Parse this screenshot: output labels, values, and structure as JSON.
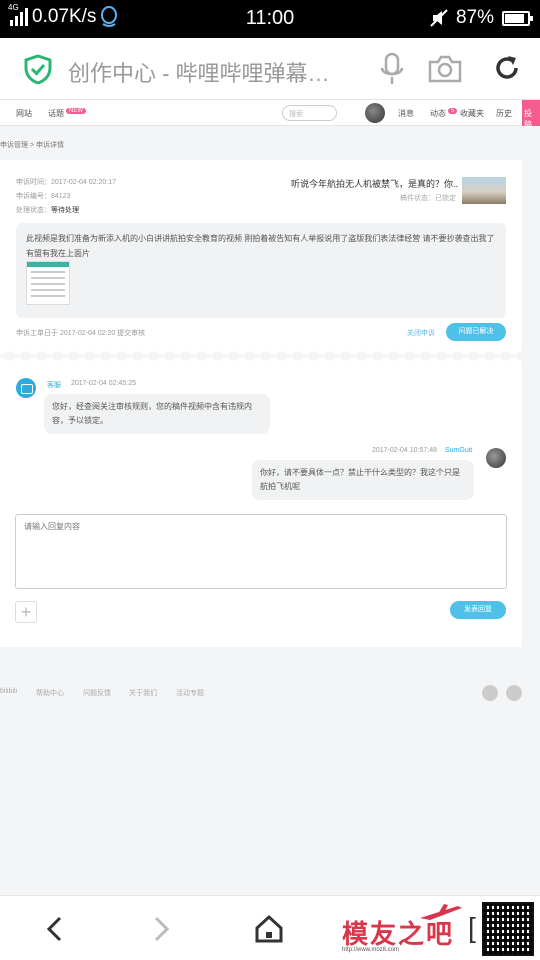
{
  "status_bar": {
    "network": "4G",
    "speed": "0.07K/s",
    "time": "11:00",
    "battery": "87%",
    "battery_level": 0.87
  },
  "browser": {
    "title": "创作中心 - 哔哩哔哩弹幕…"
  },
  "site_nav": {
    "items": [
      "网站",
      "话题",
      "消息",
      "动态",
      "收藏夹",
      "历史"
    ],
    "search_placeholder": "搜索",
    "dynamic_badge": "5",
    "topic_badge": "NEW",
    "pink_tab": "投稿"
  },
  "breadcrumb": "申诉管理 > 申诉详情",
  "appeal": {
    "time_label": "申诉时间：2017-02-04 02:20:17",
    "id_label": "申诉编号：84123",
    "status_label": "处理状态：",
    "status_value": "等待处理",
    "video_title": "听说今年航拍无人机被禁飞，是真的？你..",
    "video_sub": "稿件状态：已锁定",
    "description": "此视频是我们准备为新添入机的小白讲讲航拍安全教育的视频 刚拍着被告知有人举报说用了盗版我们表法律经营 请不要抄袭查出我了有盟有我在上面片",
    "footer": "申诉工单日于 2017-02-04 02:20 提交审核",
    "close_link": "关闭申诉",
    "resolved_button": "问题已解决"
  },
  "chat": {
    "bot": {
      "name": "客服",
      "time": "2017-02-04 02:45:25",
      "message": "您好，经查阅关注审核规则，您的稿件视频中含有违规内容，予以锁定。"
    },
    "user": {
      "name": "SumGuit",
      "time": "2017-02-04 10:57:48",
      "message": "你好，请不要具体一点？禁止干什么类型的？我这个只是航拍飞机呢"
    },
    "reply_placeholder": "请输入回复内容",
    "add_label": "+",
    "send_button": "发表回复"
  },
  "footer": {
    "links": [
      "bilibili",
      "帮助中心",
      "问题反馈",
      "关于我们",
      "活动专题"
    ]
  },
  "watermark": {
    "text": "模友之吧",
    "url": "http://www.moz8.com"
  }
}
